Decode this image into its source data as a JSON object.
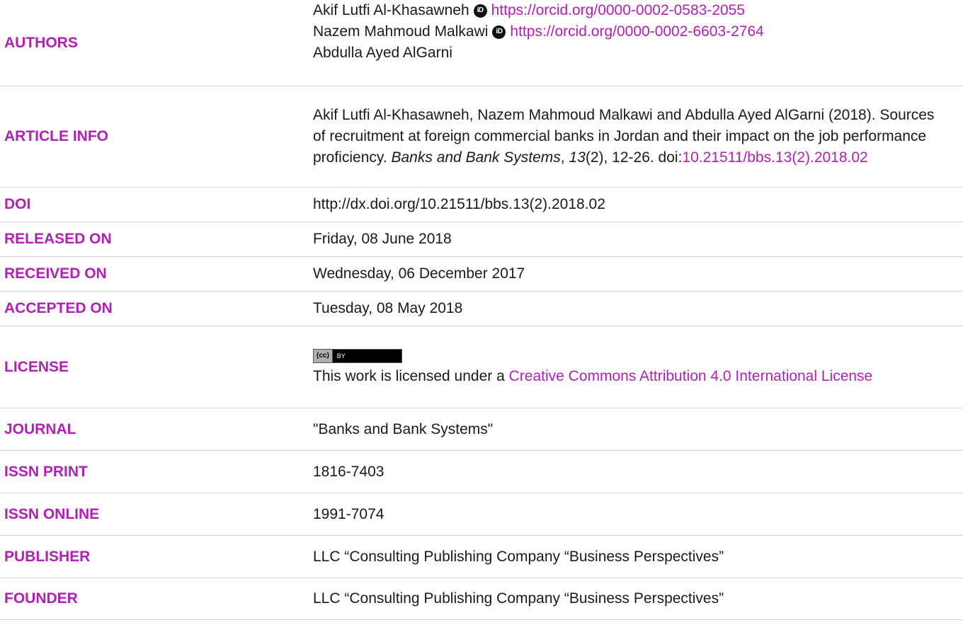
{
  "authors": {
    "label": "AUTHORS",
    "list": [
      {
        "name": "Akif Lutfi Al-Khasawneh",
        "orcid": "https://orcid.org/0000-0002-0583-2055"
      },
      {
        "name": "Nazem Mahmoud Malkawi",
        "orcid": "https://orcid.org/0000-0002-6603-2764"
      },
      {
        "name": "Abdulla Ayed AlGarni"
      }
    ],
    "orcid_icon_text": "iD"
  },
  "article_info": {
    "label": "ARTICLE INFO",
    "citation_prefix": "Akif Lutfi Al-Khasawneh, Nazem Mahmoud Malkawi and Abdulla Ayed AlGarni (2018). Sources of recruitment at foreign commercial banks in Jordan and their impact on the job performance proficiency. ",
    "journal_italic": "Banks and Bank Systems",
    "comma": ", ",
    "volume_italic": "13",
    "issue_pages": "(2), 12-26. doi:",
    "doi_link": "10.21511/bbs.13(2).2018.02"
  },
  "doi": {
    "label": "DOI",
    "value": "http://dx.doi.org/10.21511/bbs.13(2).2018.02"
  },
  "released": {
    "label": "RELEASED ON",
    "value": "Friday, 08 June 2018"
  },
  "received": {
    "label": "RECEIVED ON",
    "value": "Wednesday, 06 December 2017"
  },
  "accepted": {
    "label": "ACCEPTED ON",
    "value": "Tuesday, 08 May 2018"
  },
  "license": {
    "label": "LICENSE",
    "badge_cc": "(cc)",
    "badge_by": "BY",
    "text_prefix": "This work is licensed under a ",
    "link": "Creative Commons Attribution 4.0 International License"
  },
  "journal": {
    "label": "JOURNAL",
    "value": "\"Banks and Bank Systems\""
  },
  "issn_print": {
    "label": "ISSN PRINT",
    "value": "1816-7403"
  },
  "issn_online": {
    "label": "ISSN ONLINE",
    "value": "1991-7074"
  },
  "publisher": {
    "label": "PUBLISHER",
    "value": "LLC “Consulting Publishing Company “Business Perspectives”"
  },
  "founder": {
    "label": "FOUNDER",
    "value": "LLC “Consulting Publishing Company “Business Perspectives”"
  }
}
